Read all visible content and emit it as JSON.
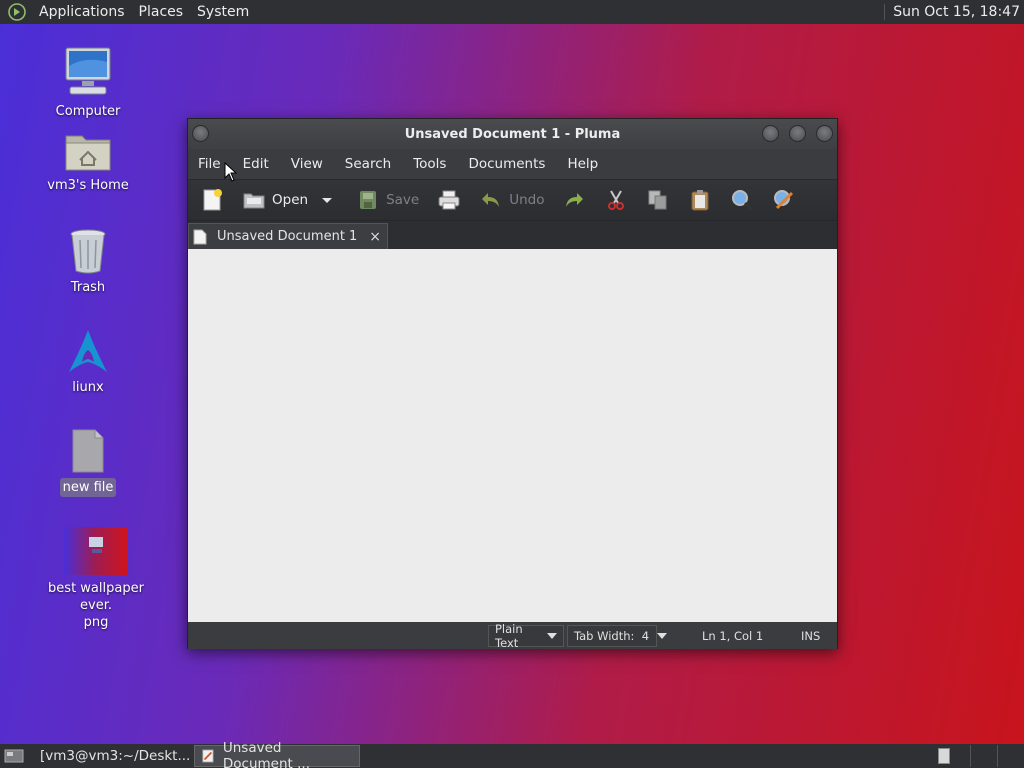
{
  "top_panel": {
    "menus": [
      "Applications",
      "Places",
      "System"
    ],
    "clock": "Sun Oct 15, 18:47"
  },
  "desktop": {
    "icons": [
      {
        "label": "Computer"
      },
      {
        "label": "vm3's Home"
      },
      {
        "label": "Trash"
      },
      {
        "label": "liunx"
      },
      {
        "label": "new file",
        "selected": true
      },
      {
        "label": "best wallpaper ever.\npng"
      }
    ]
  },
  "window": {
    "title": "Unsaved Document 1 - Pluma",
    "menubar": [
      "File",
      "Edit",
      "View",
      "Search",
      "Tools",
      "Documents",
      "Help"
    ],
    "toolbar": {
      "open_label": "Open",
      "save_label": "Save",
      "undo_label": "Undo"
    },
    "tab": {
      "label": "Unsaved Document 1",
      "close": "×"
    },
    "statusbar": {
      "language": "Plain Text",
      "tab_width": "Tab Width:  4",
      "position": "Ln 1, Col 1",
      "mode": "INS"
    }
  },
  "taskbar": {
    "items": [
      {
        "label": "[vm3@vm3:~/Deskt..."
      },
      {
        "label": "Unsaved Document ...",
        "active": true
      }
    ]
  },
  "colors": {
    "panel": "#2f3034",
    "window": "#3b3c40",
    "editor": "#ececec",
    "arch_blue": "#1793d1"
  }
}
